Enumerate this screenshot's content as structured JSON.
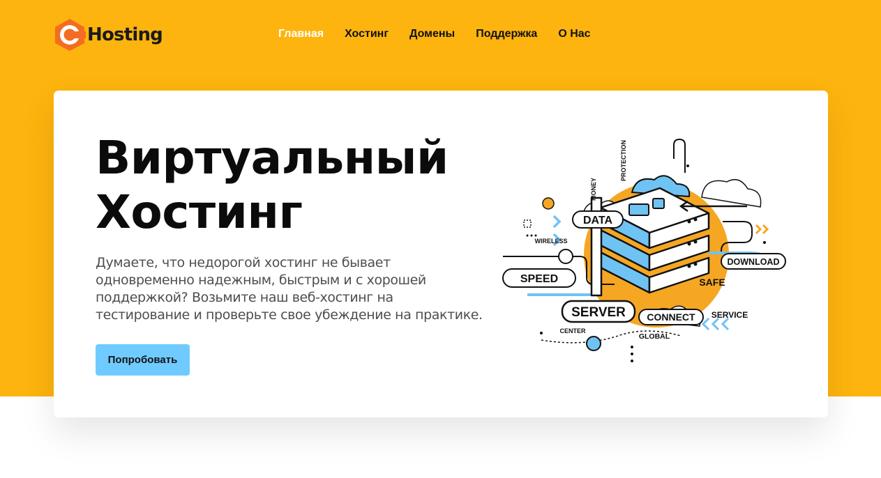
{
  "brand": {
    "name": "Hosting",
    "accent": "#fdb40e",
    "logo_orange": "#f36c21"
  },
  "nav": [
    {
      "label": "Главная",
      "active": true
    },
    {
      "label": "Хостинг",
      "active": false
    },
    {
      "label": "Домены",
      "active": false
    },
    {
      "label": "Поддержка",
      "active": false
    },
    {
      "label": "О Нас",
      "active": false
    }
  ],
  "hero": {
    "title_lines": [
      "Виртуальный",
      "Хостинг"
    ],
    "description_lines": [
      "Думаете, что недорогой хостинг не бывает",
      "одновременно надежным, быстрым и с хорошей",
      "поддержкой? Возьмите наш веб-хостинг на",
      "тестирование и проверьте свое убеждение на практике."
    ],
    "cta_label": "Попробовать",
    "cta_color": "#6fcbff"
  },
  "illustration": {
    "labels": {
      "data": "DATA",
      "speed": "SPEED",
      "server": "SERVER",
      "connect": "CONNECT",
      "download": "DOWNLOAD",
      "safe": "SAFE",
      "service": "SERVICE",
      "center": "CENTER",
      "global": "GLOBAL",
      "wireless": "WIRELESS",
      "money": "MONEY",
      "protection": "PROTECTION"
    },
    "colors": {
      "blue": "#6fc3f2",
      "orange": "#f5a623",
      "ink": "#111111"
    }
  }
}
